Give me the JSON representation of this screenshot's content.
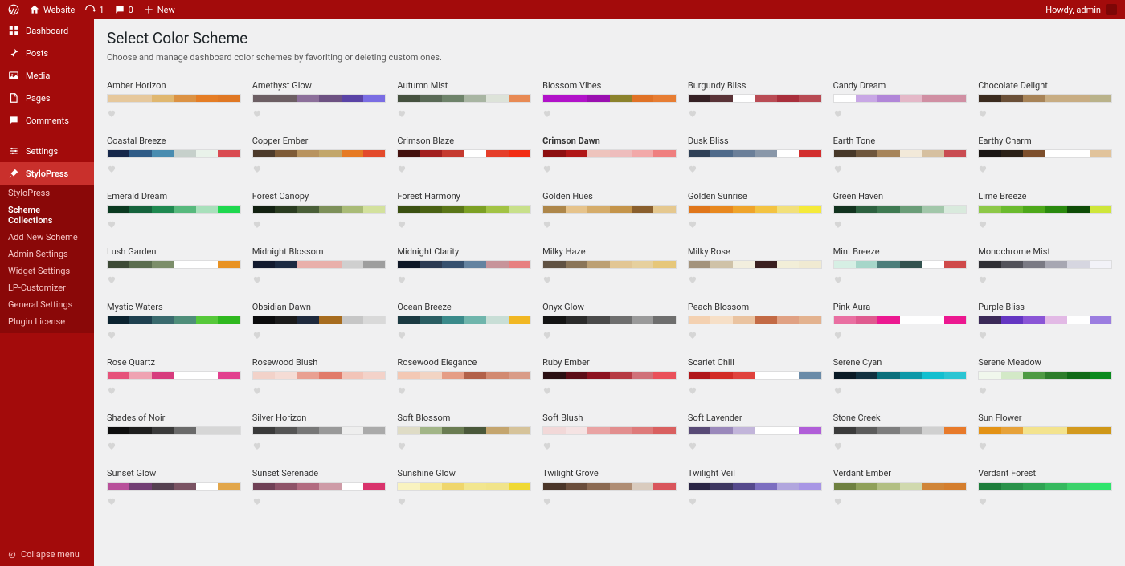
{
  "toolbar": {
    "site_name": "Website",
    "updates": "1",
    "comments": "0",
    "new": "New",
    "howdy": "Howdy, admin"
  },
  "sidebar": {
    "items": [
      {
        "label": "Dashboard",
        "icon": "dashboard"
      },
      {
        "label": "Posts",
        "icon": "pin"
      },
      {
        "label": "Media",
        "icon": "media"
      },
      {
        "label": "Pages",
        "icon": "page"
      },
      {
        "label": "Comments",
        "icon": "comment"
      },
      {
        "label": "Settings",
        "icon": "settings"
      },
      {
        "label": "StyloPress",
        "icon": "brush",
        "active": true
      }
    ],
    "submenu": [
      {
        "label": "StyloPress"
      },
      {
        "label": "Scheme Collections",
        "current": true
      },
      {
        "label": "Add New Scheme"
      },
      {
        "label": "Admin Settings"
      },
      {
        "label": "Widget Settings"
      },
      {
        "label": "LP-Customizer"
      },
      {
        "label": "General Settings"
      },
      {
        "label": "Plugin License"
      }
    ],
    "collapse": "Collapse menu"
  },
  "page": {
    "title": "Select Color Scheme",
    "subtitle": "Choose and manage dashboard color schemes by favoriting or deleting custom ones."
  },
  "schemes": [
    {
      "name": "Amber Horizon",
      "colors": [
        "#e6c89c",
        "#e6c89c",
        "#e0b76f",
        "#dc9243",
        "#e57d25",
        "#e07824"
      ]
    },
    {
      "name": "Amethyst Glow",
      "colors": [
        "#6c5e63",
        "#6c5e63",
        "#8c6f9a",
        "#6d5182",
        "#5a43a6",
        "#7a6de3"
      ]
    },
    {
      "name": "Autumn Mist",
      "colors": [
        "#45513f",
        "#5a6a56",
        "#6e836a",
        "#a8b5a2",
        "#dde3d9",
        "#e88a54"
      ]
    },
    {
      "name": "Blossom Vibes",
      "colors": [
        "#b112c9",
        "#b112c9",
        "#9a0fb0",
        "#8b822c",
        "#e07226",
        "#e77d33"
      ]
    },
    {
      "name": "Burgundy Bliss",
      "colors": [
        "#352024",
        "#5a3337",
        "#ffffff",
        "#b94b54",
        "#a92f3c",
        "#b84a53"
      ]
    },
    {
      "name": "Candy Dream",
      "colors": [
        "#ffffff",
        "#c8a7e5",
        "#b186d8",
        "#e4b8c8",
        "#d08fa3",
        "#d08fa3"
      ]
    },
    {
      "name": "Chocolate Delight",
      "colors": [
        "#3b2b1f",
        "#6a4f37",
        "#a78357",
        "#c8ad83",
        "#c8ad83",
        "#b9b28a"
      ]
    },
    {
      "name": "Coastal Breeze",
      "colors": [
        "#16274a",
        "#2f5b86",
        "#498cb0",
        "#c6d0cb",
        "#e9f2ea",
        "#d94b51"
      ]
    },
    {
      "name": "Copper Ember",
      "colors": [
        "#4d3b2b",
        "#7e5b37",
        "#b8935f",
        "#c2a66a",
        "#e67a23",
        "#e34a2b"
      ]
    },
    {
      "name": "Crimson Blaze",
      "colors": [
        "#43110e",
        "#a21f1f",
        "#c53a30",
        "#ffffff",
        "#e53e2a",
        "#f22c13"
      ]
    },
    {
      "name": "Crimson Dawn",
      "active": true,
      "colors": [
        "#8d0f10",
        "#b01616",
        "#eec4bd",
        "#eebdbd",
        "#f2a9a9",
        "#ef7f7f"
      ]
    },
    {
      "name": "Dusk Bliss",
      "colors": [
        "#2f4056",
        "#4f6a8a",
        "#6b7f99",
        "#8997a9",
        "#ffffff",
        "#d22e2e"
      ]
    },
    {
      "name": "Earth Tone",
      "colors": [
        "#473829",
        "#6e563c",
        "#a6845a",
        "#f2e9d9",
        "#d6c0a0",
        "#c94c52"
      ]
    },
    {
      "name": "Earthy Charm",
      "colors": [
        "#191513",
        "#2b2117",
        "#7d4f2c",
        "#ffffff",
        "#ffffff",
        "#e1c39b"
      ]
    },
    {
      "name": "Emerald Dream",
      "colors": [
        "#0b3a21",
        "#15633c",
        "#1f8950",
        "#57b97d",
        "#a8e0bb",
        "#1fd84f"
      ]
    },
    {
      "name": "Forest Canopy",
      "colors": [
        "#132111",
        "#2a3c20",
        "#4a5f38",
        "#7d9059",
        "#a9bb76",
        "#d3e19d"
      ]
    },
    {
      "name": "Forest Harmony",
      "colors": [
        "#3b5011",
        "#4a6214",
        "#5a7618",
        "#7ca024",
        "#a2c344",
        "#c8e08a"
      ]
    },
    {
      "name": "Golden Hues",
      "colors": [
        "#ae874a",
        "#e6c38b",
        "#d5ac6a",
        "#c4944a",
        "#8a5f2d",
        "#e5c88f"
      ]
    },
    {
      "name": "Golden Sunrise",
      "colors": [
        "#e0761b",
        "#e8881f",
        "#efa42b",
        "#f3c342",
        "#f2e07a",
        "#f5ea3a"
      ]
    },
    {
      "name": "Green Haven",
      "colors": [
        "#12331f",
        "#2d6140",
        "#3f7a52",
        "#6a9d78",
        "#a2c7aa",
        "#d9eadd"
      ]
    },
    {
      "name": "Lime Breeze",
      "colors": [
        "#8dc848",
        "#6bbb2e",
        "#4da81a",
        "#2a8a0e",
        "#0e4c06",
        "#cfe63a"
      ]
    },
    {
      "name": "Lush Garden",
      "colors": [
        "#3d4a36",
        "#5b6d4f",
        "#7c8e6a",
        "#ffffff",
        "#ffffff",
        "#e89223"
      ]
    },
    {
      "name": "Midnight Blossom",
      "colors": [
        "#121a2e",
        "#1c2a42",
        "#e9b0ab",
        "#e9b0ab",
        "#cfcfcf",
        "#9e9e9e"
      ]
    },
    {
      "name": "Midnight Clarity",
      "colors": [
        "#0e1726",
        "#2b3a52",
        "#36506e",
        "#6483a0",
        "#c7949a",
        "#e78080"
      ]
    },
    {
      "name": "Milky Haze",
      "colors": [
        "#605243",
        "#8a7558",
        "#bca074",
        "#e2c694",
        "#e6d09e",
        "#e6c77a"
      ]
    },
    {
      "name": "Milky Rose",
      "colors": [
        "#a3937c",
        "#cfc2a8",
        "#f2eede",
        "#3a1f1f",
        "#f2eed8",
        "#f0ead2"
      ]
    },
    {
      "name": "Mint Breeze",
      "colors": [
        "#d6efe4",
        "#a6d6c9",
        "#4c7d7a",
        "#33524f",
        "#ffffff",
        "#cf4a4a"
      ]
    },
    {
      "name": "Monochrome Mist",
      "colors": [
        "#2f2f34",
        "#52525a",
        "#7a7a84",
        "#a7a7b2",
        "#d6d6e0",
        "#f2f2f8"
      ]
    },
    {
      "name": "Mystic Waters",
      "colors": [
        "#0b2330",
        "#1f4150",
        "#3a6a6e",
        "#4f8e7a",
        "#56c83a",
        "#2fb81f"
      ]
    },
    {
      "name": "Obsidian Dawn",
      "colors": [
        "#0c0c0c",
        "#1b1b1b",
        "#1f2a3d",
        "#a76c1f",
        "#c6c6c6",
        "#d9d9d9"
      ]
    },
    {
      "name": "Ocean Breeze",
      "colors": [
        "#1b3a42",
        "#2a5d62",
        "#3a8a8a",
        "#6fb5ac",
        "#c8ded6",
        "#f1b723"
      ]
    },
    {
      "name": "Onyx Glow",
      "colors": [
        "#141414",
        "#2b2b2b",
        "#4a4a4a",
        "#6e6e6e",
        "#9a9a9a",
        "#6e6e6e"
      ]
    },
    {
      "name": "Peach Blossom",
      "colors": [
        "#f4d1b1",
        "#f6dfc7",
        "#eac3a0",
        "#c36a45",
        "#e0a183",
        "#e3b28f"
      ]
    },
    {
      "name": "Pink Aura",
      "colors": [
        "#e96fa1",
        "#df5a8f",
        "#ec1890",
        "#ffffff",
        "#ffffff",
        "#ec1890"
      ]
    },
    {
      "name": "Purple Bliss",
      "colors": [
        "#3b2a58",
        "#6436c2",
        "#8a55d6",
        "#e2b9e5",
        "#ffffff",
        "#9b7de0"
      ]
    },
    {
      "name": "Rose Quartz",
      "colors": [
        "#e6527a",
        "#efa3b2",
        "#d73c7d",
        "#ffffff",
        "#ffffff",
        "#e2408e"
      ]
    },
    {
      "name": "Rosewood Blush",
      "colors": [
        "#f2d2c9",
        "#f5dcd5",
        "#e9a092",
        "#e17b6a",
        "#f2c4b8",
        "#f3d2c9"
      ]
    },
    {
      "name": "Rosewood Elegance",
      "colors": [
        "#f3c8b4",
        "#f2d4c3",
        "#e59d85",
        "#b26149",
        "#d28a71",
        "#d99c88"
      ]
    },
    {
      "name": "Ruby Ember",
      "colors": [
        "#2a1013",
        "#5c0d17",
        "#8c111f",
        "#b63a43",
        "#d07179",
        "#ea505a"
      ]
    },
    {
      "name": "Scarlet Chill",
      "colors": [
        "#b01619",
        "#d22b26",
        "#e0423d",
        "#ffffff",
        "#ffffff",
        "#6a8ba8"
      ]
    },
    {
      "name": "Serene Cyan",
      "colors": [
        "#0a1a25",
        "#11303f",
        "#0a6e7a",
        "#0e98a8",
        "#13bfcf",
        "#2bc5d3"
      ]
    },
    {
      "name": "Serene Meadow",
      "colors": [
        "#f0f7ec",
        "#d3e9c7",
        "#4e9a43",
        "#2d7d2b",
        "#106a17",
        "#0a8a1e"
      ]
    },
    {
      "name": "Shades of Noir",
      "colors": [
        "#0e0e0e",
        "#1e1e1e",
        "#3a3a3a",
        "#6a6a6a",
        "#d6d6d6",
        "#d6d6d6"
      ]
    },
    {
      "name": "Silver Horizon",
      "colors": [
        "#3a3a3a",
        "#555555",
        "#777777",
        "#999999",
        "#eeeeee",
        "#aaaaaa"
      ]
    },
    {
      "name": "Soft Blossom",
      "colors": [
        "#dfdcc6",
        "#a2b587",
        "#6a7c52",
        "#4a583a",
        "#c4a56e",
        "#d6c39a"
      ]
    },
    {
      "name": "Soft Blush",
      "colors": [
        "#f2d8d8",
        "#f5e3e3",
        "#e9a3a3",
        "#e28e8e",
        "#de7a7a",
        "#d96060"
      ]
    },
    {
      "name": "Soft Lavender",
      "colors": [
        "#584a76",
        "#9a88bb",
        "#c2b5da",
        "#ffffff",
        "#ffffff",
        "#b05ed8"
      ]
    },
    {
      "name": "Stone Creek",
      "colors": [
        "#3b3b3b",
        "#5c5c5c",
        "#7d7d7d",
        "#a2a2a2",
        "#d0d0d0",
        "#e87a2a"
      ]
    },
    {
      "name": "Sun Flower",
      "colors": [
        "#e39215",
        "#e7a239",
        "#f3e38e",
        "#f3e38e",
        "#d39a1f",
        "#cf9718"
      ]
    },
    {
      "name": "Sunset Glow",
      "colors": [
        "#b8509a",
        "#723e74",
        "#554050",
        "#7a5363",
        "#ffffff",
        "#e2a64a"
      ]
    },
    {
      "name": "Sunset Serenade",
      "colors": [
        "#6f4055",
        "#8e5368",
        "#b26b80",
        "#ce9ba7",
        "#ffffff",
        "#d9336c"
      ]
    },
    {
      "name": "Sunshine Glow",
      "colors": [
        "#f9f3c0",
        "#f6ea9c",
        "#efd66c",
        "#f2e68f",
        "#f1e48a",
        "#f0d933"
      ]
    },
    {
      "name": "Twilight Grove",
      "colors": [
        "#4a3528",
        "#6a4d3b",
        "#8b6a52",
        "#af8d74",
        "#d9cbbe",
        "#d9555c"
      ]
    },
    {
      "name": "Twilight Veil",
      "colors": [
        "#2a2545",
        "#3d3660",
        "#55498c",
        "#7c6ec0",
        "#b1a6de",
        "#a896e5"
      ]
    },
    {
      "name": "Verdant Ember",
      "colors": [
        "#6e8040",
        "#8fa05a",
        "#b2bf83",
        "#d0d9ae",
        "#d08538",
        "#d47e2e"
      ]
    },
    {
      "name": "Verdant Forest",
      "colors": [
        "#1d7d3b",
        "#29924a",
        "#2fa353",
        "#36b95f",
        "#3cd26b",
        "#30e56d"
      ]
    }
  ]
}
